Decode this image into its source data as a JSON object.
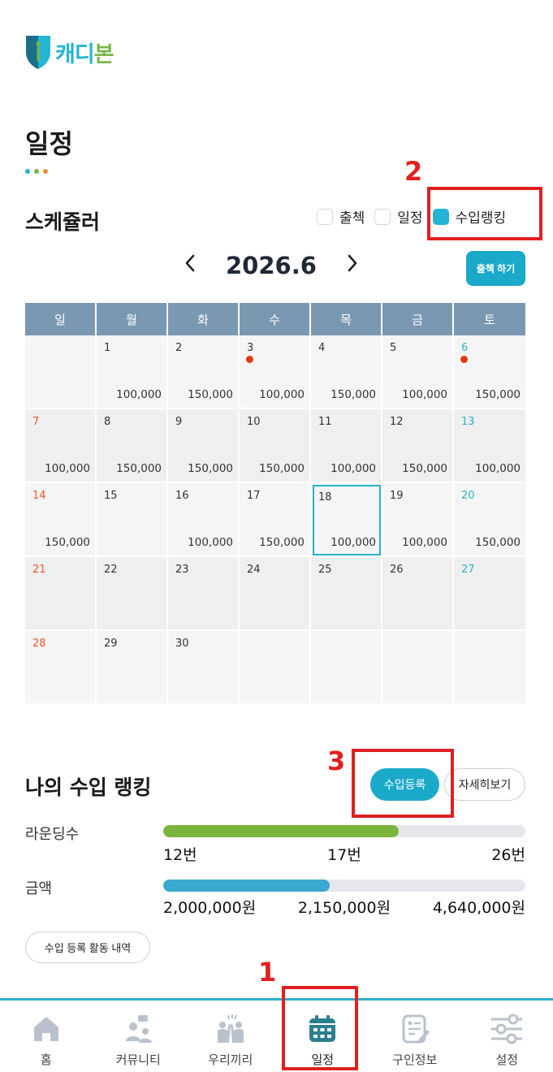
{
  "app": {
    "logo_text_a": "캐디",
    "logo_text_b": "본"
  },
  "page": {
    "title": "일정",
    "dot_colors": [
      "#23b5d3",
      "#7ab648",
      "#e8912f"
    ]
  },
  "scheduler": {
    "title": "스케쥴러",
    "filters": [
      {
        "label": "출첵",
        "checked": false
      },
      {
        "label": "일정",
        "checked": false
      },
      {
        "label": "수입랭킹",
        "checked": true
      }
    ],
    "prev_icon": "chevron-left-icon",
    "next_icon": "chevron-right-icon",
    "month_label": "2026.6",
    "attend_button": "출첵 하기",
    "weekdays": [
      "일",
      "월",
      "화",
      "수",
      "목",
      "금",
      "토"
    ],
    "days": [
      {
        "day": "",
        "amount": ""
      },
      {
        "day": "1",
        "amount": "100,000"
      },
      {
        "day": "2",
        "amount": "150,000"
      },
      {
        "day": "3",
        "amount": "100,000",
        "mark": true
      },
      {
        "day": "4",
        "amount": "150,000"
      },
      {
        "day": "5",
        "amount": "100,000"
      },
      {
        "day": "6",
        "amount": "150,000",
        "mark": true
      },
      {
        "day": "7",
        "amount": "100,000"
      },
      {
        "day": "8",
        "amount": "150,000"
      },
      {
        "day": "9",
        "amount": "150,000"
      },
      {
        "day": "10",
        "amount": "150,000"
      },
      {
        "day": "11",
        "amount": "100,000"
      },
      {
        "day": "12",
        "amount": "150,000"
      },
      {
        "day": "13",
        "amount": "100,000"
      },
      {
        "day": "14",
        "amount": "150,000"
      },
      {
        "day": "15",
        "amount": ""
      },
      {
        "day": "16",
        "amount": "100,000"
      },
      {
        "day": "17",
        "amount": "150,000"
      },
      {
        "day": "18",
        "amount": "100,000",
        "today": true
      },
      {
        "day": "19",
        "amount": "100,000"
      },
      {
        "day": "20",
        "amount": "150,000"
      },
      {
        "day": "21",
        "amount": ""
      },
      {
        "day": "22",
        "amount": ""
      },
      {
        "day": "23",
        "amount": ""
      },
      {
        "day": "24",
        "amount": ""
      },
      {
        "day": "25",
        "amount": ""
      },
      {
        "day": "26",
        "amount": ""
      },
      {
        "day": "27",
        "amount": ""
      },
      {
        "day": "28",
        "amount": ""
      },
      {
        "day": "29",
        "amount": ""
      },
      {
        "day": "30",
        "amount": ""
      },
      {
        "day": "",
        "amount": ""
      },
      {
        "day": "",
        "amount": ""
      },
      {
        "day": "",
        "amount": ""
      },
      {
        "day": "",
        "amount": ""
      }
    ],
    "colors": {
      "sunday": "#e8582f",
      "saturday": "#2cb2c8",
      "mark": "#e03a12",
      "header_bg": "#7b98b3"
    }
  },
  "ranking": {
    "title": "나의 수입 랭킹",
    "register_button": "수입등록",
    "detail_button": "자세히보기",
    "rounds": {
      "label": "라운딩수",
      "progress": 0.65,
      "color": "#7ab43a",
      "min": "12번",
      "value": "17번",
      "max": "26번"
    },
    "amount": {
      "label": "금액",
      "progress": 0.46,
      "color": "#3aa8cf",
      "min": "2,000,000원",
      "value": "2,150,000원",
      "max": "4,640,000원"
    },
    "history_button": "수입 등록 활동 내역"
  },
  "callouts": [
    "1",
    "2",
    "3"
  ],
  "bottom_nav": [
    {
      "label": "홈",
      "icon": "home-icon"
    },
    {
      "label": "커뮤니티",
      "icon": "community-icon"
    },
    {
      "label": "우리끼리",
      "icon": "friends-icon"
    },
    {
      "label": "일정",
      "icon": "calendar-icon",
      "active": true
    },
    {
      "label": "구인정보",
      "icon": "job-info-icon"
    },
    {
      "label": "설정",
      "icon": "settings-sliders-icon"
    }
  ]
}
